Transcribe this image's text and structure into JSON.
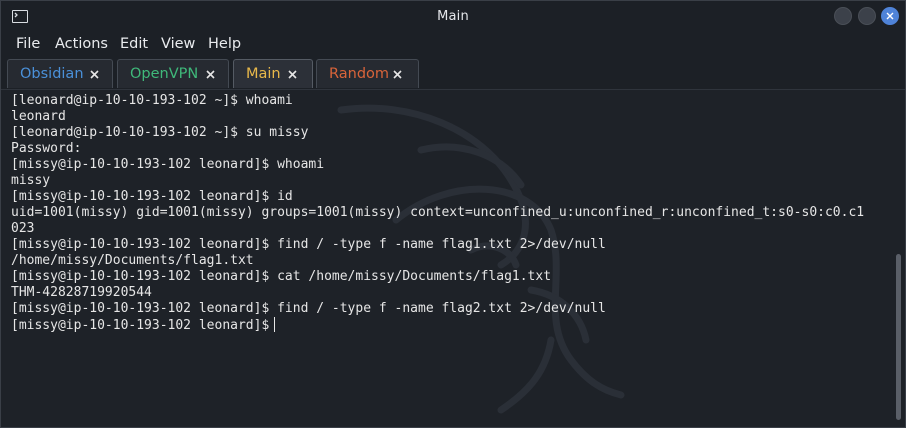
{
  "window": {
    "title": "Main"
  },
  "menu": {
    "items": [
      {
        "label": "File"
      },
      {
        "label": "Actions"
      },
      {
        "label": "Edit"
      },
      {
        "label": "View"
      },
      {
        "label": "Help"
      }
    ]
  },
  "tabs": [
    {
      "label": "Obsidian",
      "color": "#4a90d9",
      "active": false
    },
    {
      "label": "OpenVPN",
      "color": "#3fb87a",
      "active": false
    },
    {
      "label": "Main",
      "color": "#e8b84a",
      "active": true
    },
    {
      "label": "Random",
      "color": "#d9643a",
      "active": false
    }
  ],
  "terminal": {
    "lines": [
      "[leonard@ip-10-10-193-102 ~]$ whoami",
      "leonard",
      "[leonard@ip-10-10-193-102 ~]$ su missy",
      "Password:",
      "[missy@ip-10-10-193-102 leonard]$ whoami",
      "missy",
      "[missy@ip-10-10-193-102 leonard]$ id",
      "uid=1001(missy) gid=1001(missy) groups=1001(missy) context=unconfined_u:unconfined_r:unconfined_t:s0-s0:c0.c1",
      "023",
      "[missy@ip-10-10-193-102 leonard]$ find / -type f -name flag1.txt 2>/dev/null",
      "/home/missy/Documents/flag1.txt",
      "[missy@ip-10-10-193-102 leonard]$ cat /home/missy/Documents/flag1.txt",
      "THM-42828719920544",
      "[missy@ip-10-10-193-102 leonard]$ find / -type f -name flag2.txt 2>/dev/null",
      "[missy@ip-10-10-193-102 leonard]$"
    ]
  }
}
